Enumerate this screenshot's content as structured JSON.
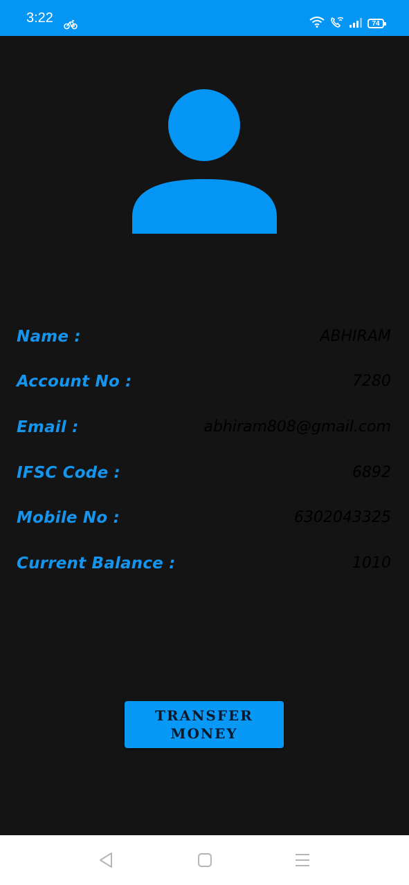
{
  "status_bar": {
    "time": "3:22",
    "battery": "74",
    "background_color": "#0596f5",
    "icons": [
      "bike-icon",
      "wifi-icon",
      "wifi-call-icon",
      "signal-icon",
      "battery-icon"
    ]
  },
  "profile": {
    "avatar_icon": "person-icon",
    "accent_color": "#0596f5"
  },
  "details": [
    {
      "label": "Name :",
      "value": "ABHIRAM"
    },
    {
      "label": "Account No :",
      "value": "7280"
    },
    {
      "label": "Email :",
      "value": "abhiram808@gmail.com"
    },
    {
      "label": "IFSC Code :",
      "value": "6892"
    },
    {
      "label": "Mobile No :",
      "value": "6302043325"
    },
    {
      "label": "Current Balance :",
      "value": "1010"
    }
  ],
  "actions": {
    "transfer_label": "TRANSFER MONEY"
  },
  "nav_bar": {
    "icons": [
      "back-icon",
      "home-icon",
      "menu-icon"
    ]
  }
}
